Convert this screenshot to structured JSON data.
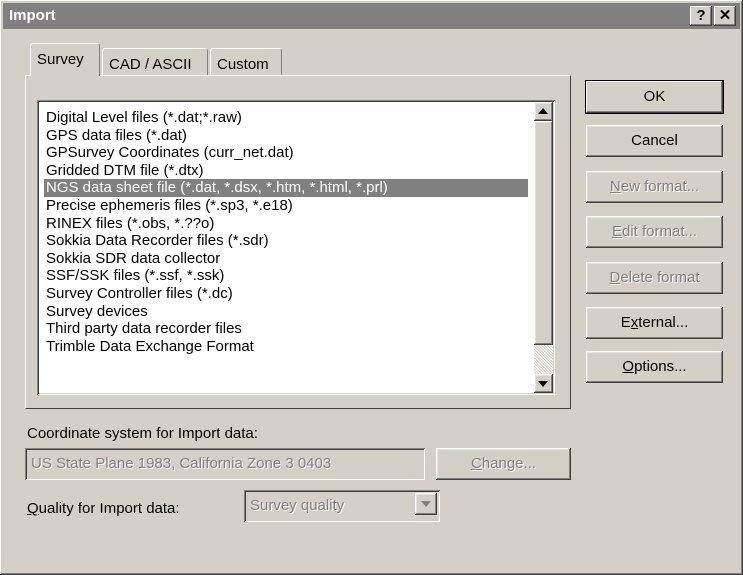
{
  "window": {
    "title": "Import",
    "help_label": "?",
    "close_label": "✕"
  },
  "tabs": [
    {
      "label": "Survey",
      "active": true
    },
    {
      "label": "CAD / ASCII",
      "active": false
    },
    {
      "label": "Custom",
      "active": false
    }
  ],
  "format_list": {
    "items": [
      "Digital Level files (*.dat;*.raw)",
      "GPS data files (*.dat)",
      "GPSurvey Coordinates (curr_net.dat)",
      "Gridded DTM file (*.dtx)",
      "NGS data sheet file (*.dat, *.dsx, *.htm, *.html, *.prl)",
      "Precise ephemeris files (*.sp3, *.e18)",
      "RINEX files (*.obs, *.??o)",
      "Sokkia Data Recorder files (*.sdr)",
      "Sokkia SDR data collector",
      "SSF/SSK files (*.ssf, *.ssk)",
      "Survey Controller files (*.dc)",
      "Survey devices",
      "Third party data recorder files",
      "Trimble Data Exchange Format"
    ],
    "selected_index": 4
  },
  "buttons": {
    "ok": "OK",
    "cancel": "Cancel",
    "new_format": {
      "pre": "",
      "key": "N",
      "post": "ew format..."
    },
    "edit_format": {
      "pre": "",
      "key": "E",
      "post": "dit format..."
    },
    "delete_format": {
      "pre": "",
      "key": "D",
      "post": "elete format"
    },
    "external": {
      "pre": "E",
      "key": "x",
      "post": "ternal..."
    },
    "options": {
      "pre": "",
      "key": "O",
      "post": "ptions..."
    }
  },
  "coordinate_system": {
    "label": "Coordinate system for Import data:",
    "value": "US State Plane 1983, California Zone 3 0403",
    "change_button": {
      "pre": "",
      "key": "C",
      "post": "hange..."
    }
  },
  "quality": {
    "label": {
      "pre": "",
      "key": "Q",
      "post": "uality for Import data:"
    },
    "value": "Survey quality"
  }
}
